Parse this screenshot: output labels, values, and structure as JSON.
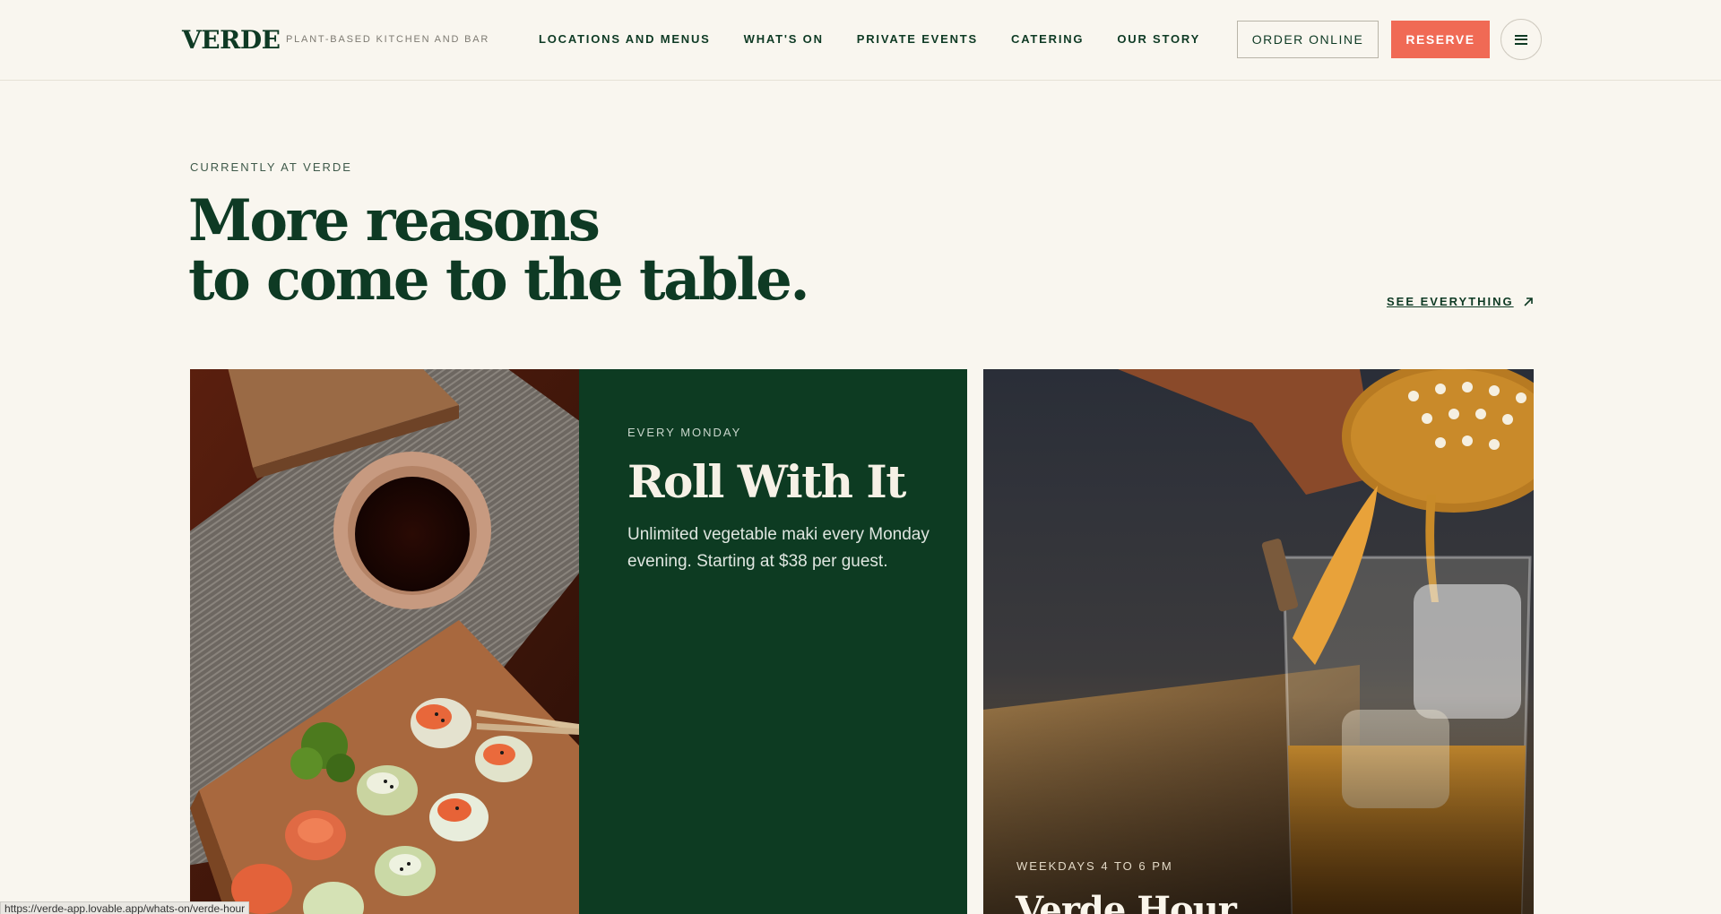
{
  "header": {
    "logo": "VERDE",
    "tagline": "PLANT-BASED KITCHEN AND BAR",
    "nav": [
      {
        "label": "LOCATIONS AND MENUS"
      },
      {
        "label": "WHAT'S ON"
      },
      {
        "label": "PRIVATE EVENTS"
      },
      {
        "label": "CATERING"
      },
      {
        "label": "OUR STORY"
      }
    ],
    "order_label": "ORDER ONLINE",
    "reserve_label": "RESERVE"
  },
  "intro": {
    "eyebrow": "CURRENTLY AT VERDE",
    "headline_line1": "More reasons",
    "headline_line2": "to come to the table.",
    "see_all": "SEE EVERYTHING"
  },
  "cards": {
    "roll": {
      "label": "EVERY MONDAY",
      "title": "Roll With It",
      "description": "Unlimited vegetable maki every Monday evening. Starting at $38 per guest."
    },
    "hour": {
      "label": "WEEKDAYS 4 TO 6 PM",
      "title": "Verde Hour"
    }
  },
  "status_url": "https://verde-app.lovable.app/whats-on/verde-hour",
  "colors": {
    "background": "#f9f6ef",
    "brand_green": "#0d3b22",
    "accent_coral": "#f06a55"
  }
}
